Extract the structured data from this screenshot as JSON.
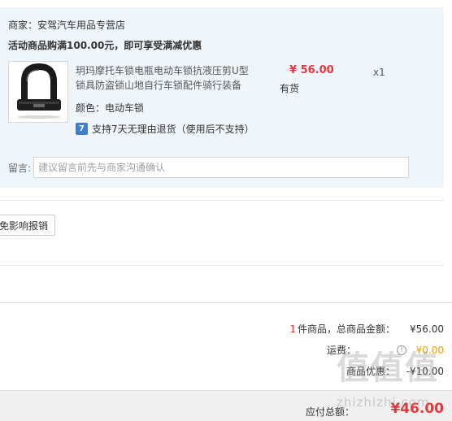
{
  "order": {
    "seller_label": "商家：",
    "seller_name": "安驾汽车用品专营店",
    "promo": "活动商品购满100.00元，即可享受满减优惠",
    "product": {
      "name": "玥玛摩托车锁电瓶电动车锁抗液压剪U型锁具防盗锁山地自行车锁配件骑行装备",
      "price": "¥ 56.00",
      "stock": "有货",
      "quantity": "x1",
      "color_label": "颜色：",
      "color_value": "电动车锁",
      "return_policy": "支持7天无理由退货（使用后不支持）",
      "return_icon": "7",
      "thumbnail_icon": "u-lock-icon"
    },
    "message_label": "留言:",
    "message_placeholder": "建议留言前先与商家沟通确认"
  },
  "partial_button_label": "免影响报销",
  "summary": {
    "item_count": "1",
    "items_total_label": "件商品，总商品金额：",
    "items_total_value": "¥56.00",
    "freight_label": "运费：",
    "freight_value": "¥0.00",
    "discount_label": "商品优惠：",
    "discount_value": "-¥10.00"
  },
  "total": {
    "label": "应付总额：",
    "value": "¥46.00"
  },
  "watermark": {
    "glyphs": "值值值",
    "text": "zhizhizhi.com"
  },
  "colors": {
    "price_red": "#e4393c",
    "freight_orange": "#f0a000",
    "block_bg": "#eef6fc",
    "return_icon_blue": "#3d7fd0"
  }
}
